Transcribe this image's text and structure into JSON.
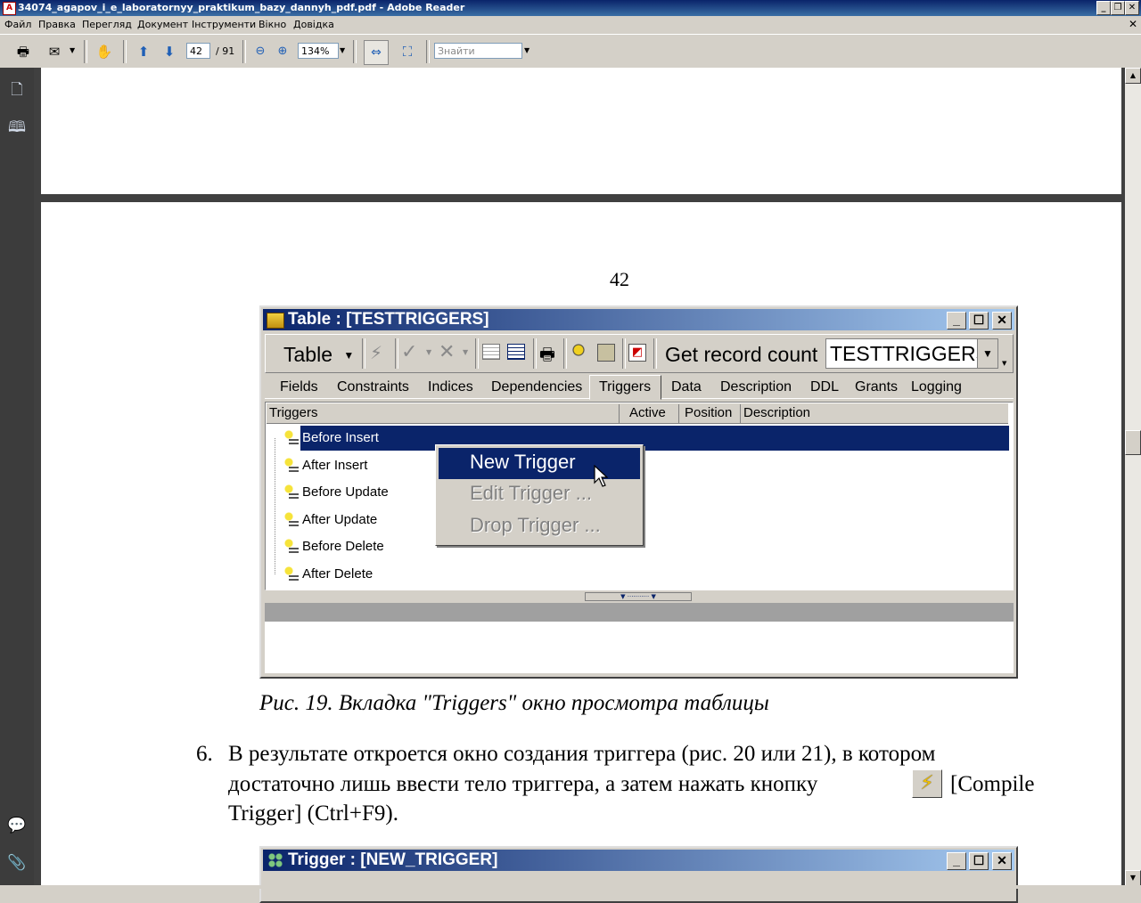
{
  "app": {
    "title": "34074_agapov_i_e_laboratornyy_praktikum_bazy_dannyh_pdf.pdf - Adobe Reader"
  },
  "menu": [
    "Файл",
    "Правка",
    "Перегляд",
    "Документ",
    "Інструменти",
    "Вікно",
    "Довідка"
  ],
  "toolbar": {
    "page_current": "42",
    "page_total": "/ 91",
    "zoom": "134%",
    "search_placeholder": "Знайти"
  },
  "page": {
    "number": "42",
    "caption": "Рис. 19. Вкладка \"Triggers\" окно просмотра таблицы",
    "item_number": "6.",
    "para_line1": "В результате откроется окно создания триггера (рис. 20 или 21), в котором",
    "para_line2a": "достаточно лишь ввести тело триггера, а затем нажать кнопку",
    "para_line2b": "[Compile",
    "para_line3": "Trigger] (Ctrl+F9)."
  },
  "table_window": {
    "title": "Table : [TESTTRIGGERS]",
    "table_menu": "Table",
    "record_count_button": "Get record count",
    "table_select": "TESTTRIGGERS",
    "tabs": [
      "Fields",
      "Constraints",
      "Indices",
      "Dependencies",
      "Triggers",
      "Data",
      "Description",
      "DDL",
      "Grants",
      "Logging"
    ],
    "columns": [
      "Triggers",
      "Active",
      "Position",
      "Description"
    ],
    "triggers": [
      "Before Insert",
      "After Insert",
      "Before Update",
      "After Update",
      "Before Delete",
      "After Delete"
    ]
  },
  "context_menu": {
    "items": [
      "New Trigger",
      "Edit Trigger ...",
      "Drop Trigger ..."
    ]
  },
  "trigger_window": {
    "title": "Trigger : [NEW_TRIGGER]"
  },
  "colors": {
    "selection": "#0a246a",
    "doc_bg": "#404040"
  }
}
